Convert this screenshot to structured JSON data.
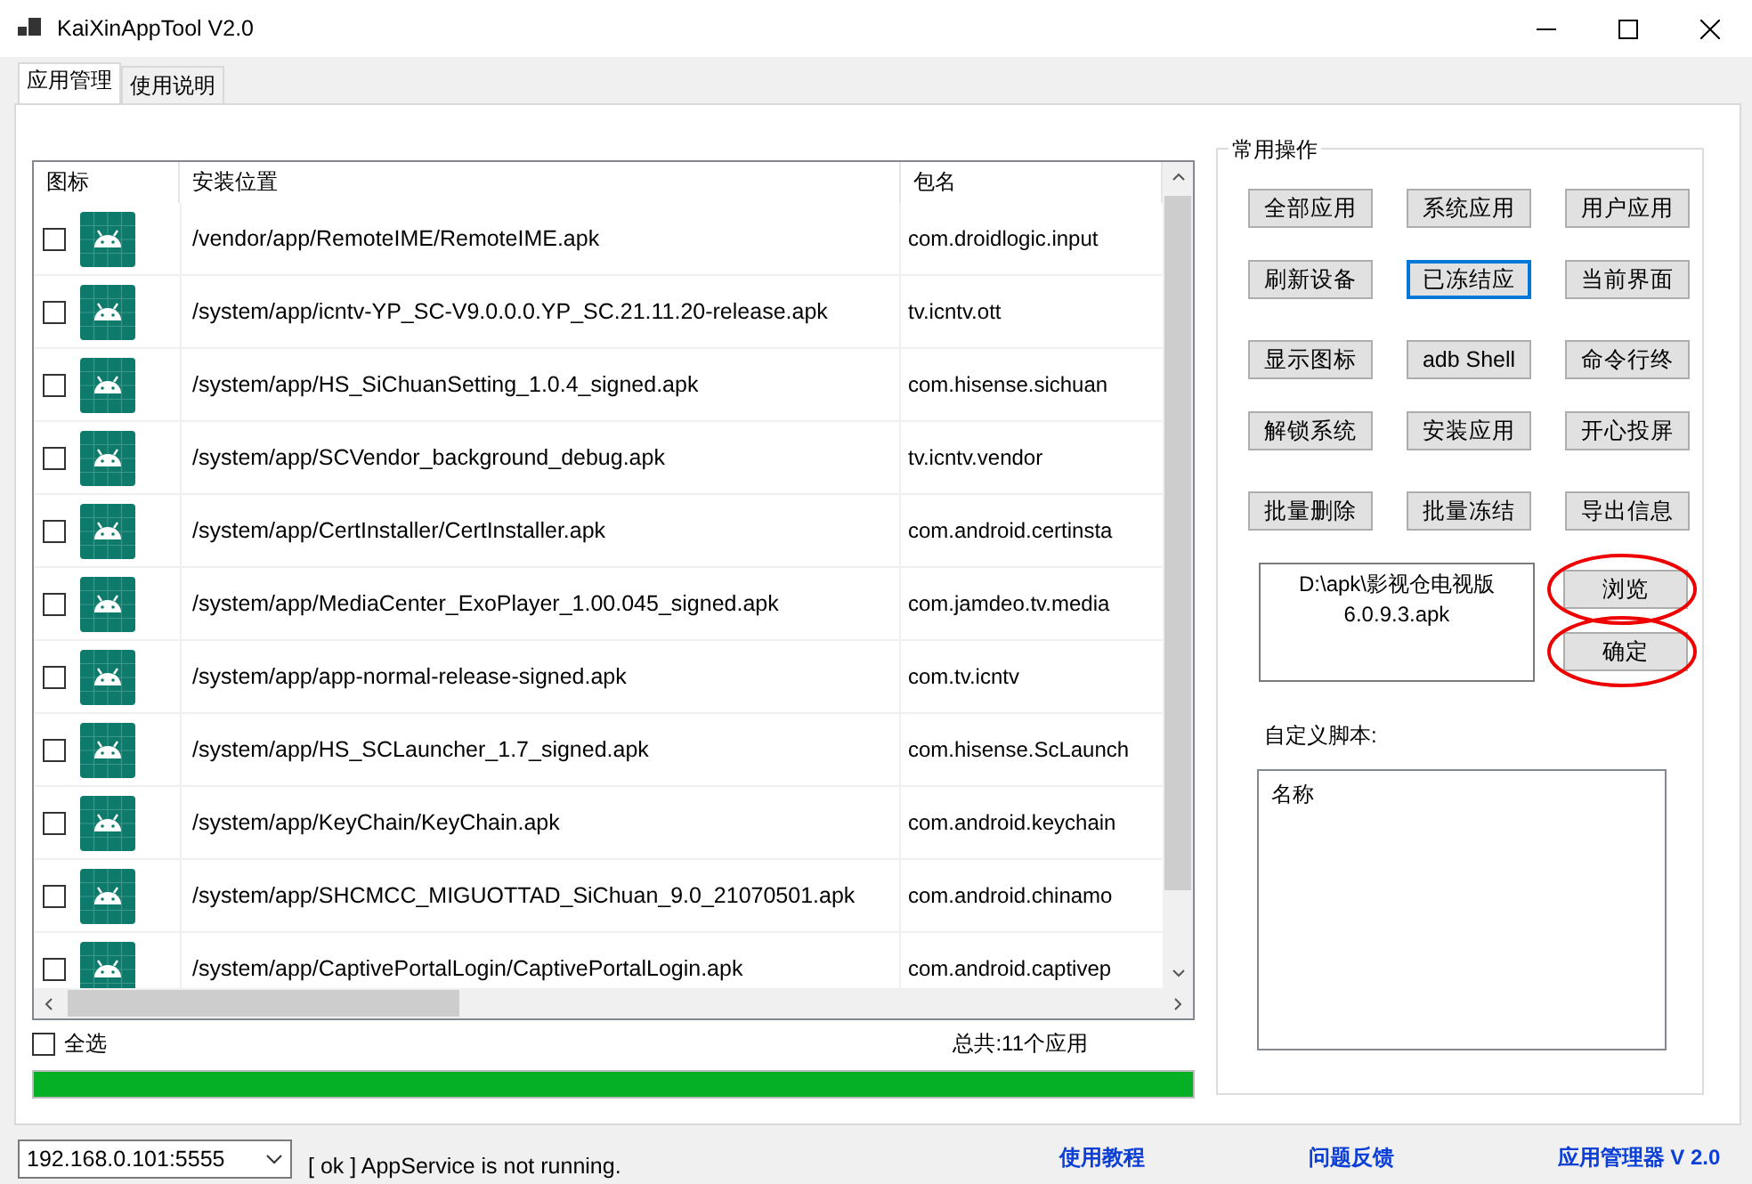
{
  "window": {
    "title": "KaiXinAppTool V2.0"
  },
  "tabs": [
    {
      "label": "应用管理",
      "selected": true
    },
    {
      "label": "使用说明",
      "selected": false
    }
  ],
  "app_list": {
    "columns": [
      "图标",
      "安装位置",
      "包名"
    ],
    "rows": [
      {
        "checked": false,
        "path": "/vendor/app/RemoteIME/RemoteIME.apk",
        "package": "com.droidlogic.input"
      },
      {
        "checked": false,
        "path": "/system/app/icntv-YP_SC-V9.0.0.0.YP_SC.21.11.20-release.apk",
        "package": "tv.icntv.ott"
      },
      {
        "checked": false,
        "path": "/system/app/HS_SiChuanSetting_1.0.4_signed.apk",
        "package": "com.hisense.sichuan"
      },
      {
        "checked": false,
        "path": "/system/app/SCVendor_background_debug.apk",
        "package": "tv.icntv.vendor"
      },
      {
        "checked": false,
        "path": "/system/app/CertInstaller/CertInstaller.apk",
        "package": "com.android.certinsta"
      },
      {
        "checked": false,
        "path": "/system/app/MediaCenter_ExoPlayer_1.00.045_signed.apk",
        "package": "com.jamdeo.tv.media"
      },
      {
        "checked": false,
        "path": "/system/app/app-normal-release-signed.apk",
        "package": "com.tv.icntv"
      },
      {
        "checked": false,
        "path": "/system/app/HS_SCLauncher_1.7_signed.apk",
        "package": "com.hisense.ScLaunch"
      },
      {
        "checked": false,
        "path": "/system/app/KeyChain/KeyChain.apk",
        "package": "com.android.keychain"
      },
      {
        "checked": false,
        "path": "/system/app/SHCMCC_MIGUOTTAD_SiChuan_9.0_21070501.apk",
        "package": "com.android.chinamo"
      },
      {
        "checked": false,
        "path": "/system/app/CaptivePortalLogin/CaptivePortalLogin.apk",
        "package": "com.android.captivep"
      }
    ]
  },
  "select_all": {
    "label": "全选",
    "checked": false
  },
  "total": "总共:11个应用",
  "progress": {
    "level": 1
  },
  "operations": {
    "title": "常用操作",
    "buttons": [
      {
        "label": "全部应用",
        "focused": false
      },
      {
        "label": "系统应用",
        "focused": false
      },
      {
        "label": "用户应用",
        "focused": false
      },
      {
        "label": "刷新设备",
        "focused": false
      },
      {
        "label": "已冻结应",
        "focused": true
      },
      {
        "label": "当前界面",
        "focused": false
      },
      {
        "label": "显示图标",
        "focused": false
      },
      {
        "label": "adb Shell",
        "focused": false
      },
      {
        "label": "命令行终",
        "focused": false
      },
      {
        "label": "解锁系统",
        "focused": false
      },
      {
        "label": "安装应用",
        "focused": false
      },
      {
        "label": "开心投屏",
        "focused": false
      },
      {
        "label": "批量删除",
        "focused": false
      },
      {
        "label": "批量冻结",
        "focused": false
      },
      {
        "label": "导出信息",
        "focused": false
      }
    ],
    "apk_path": "D:\\apk\\影视仓电视版6.0.9.3.apk",
    "browse": "浏览",
    "confirm": "确定",
    "script_label": "自定义脚本:",
    "script_column": "名称"
  },
  "status_bar": {
    "device": "192.168.0.101:5555",
    "message": "[ ok ] AppService is not running.",
    "links": [
      "使用教程",
      "问题反馈",
      "应用管理器 V 2.0"
    ]
  }
}
